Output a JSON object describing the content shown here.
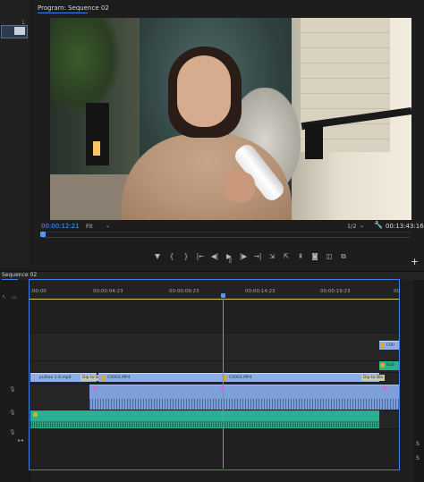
{
  "left_strip": {
    "marker": "1"
  },
  "program": {
    "title": "Program: Sequence 02",
    "timecode_current": "00:00:12:21",
    "fit": "Fit",
    "resolution": "1/2",
    "timecode_total": "00:13:43:16",
    "transport_icons": [
      "marker-icon",
      "in-point-icon",
      "out-point-icon",
      "go-to-in-icon",
      "step-back-icon",
      "play-icon",
      "step-forward-icon",
      "go-to-out-icon",
      "insert-icon",
      "overwrite-icon",
      "lift-icon",
      "camera-icon",
      "compare-icon",
      "multicam-icon"
    ]
  },
  "timeline": {
    "tab": "Sequence 02",
    "ruler_ticks": [
      ":00:00",
      "00:00:04:23",
      "00:00:09:23",
      "00:00:14:23",
      "00:00:19:23",
      "00"
    ],
    "clips": {
      "v1_a": "pulhoo 1 6.mp4",
      "v1_a_tag": "Dip to Bla",
      "v1_b": "C0003.MP4",
      "v1_c": "C0003.MP4",
      "v1_c_tag": "Dip to Bla",
      "v2_right": "C00",
      "v1_right": "Sub"
    },
    "side_labels": {
      "s1": "S",
      "s2": "S"
    }
  },
  "colors": {
    "accent": "#4a9cff",
    "video_clip": "#8bb0e6",
    "audio_clip": "#28b190"
  }
}
